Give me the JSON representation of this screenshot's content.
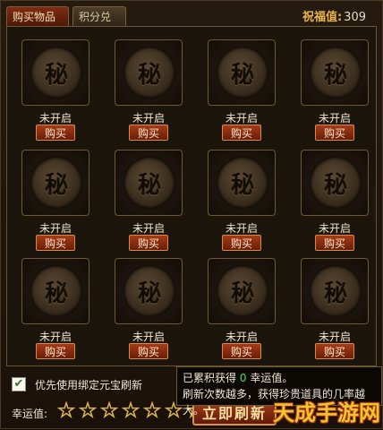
{
  "tabs": [
    {
      "label": "购买物品",
      "active": true
    },
    {
      "label": "积分兑换",
      "active": false
    }
  ],
  "blessing": {
    "label": "祝福值:",
    "value": "309"
  },
  "slots": [
    {
      "glyph": "秘",
      "status": "未开启",
      "buy_label": "购买"
    },
    {
      "glyph": "秘",
      "status": "未开启",
      "buy_label": "购买"
    },
    {
      "glyph": "秘",
      "status": "未开启",
      "buy_label": "购买"
    },
    {
      "glyph": "秘",
      "status": "未开启",
      "buy_label": "购买"
    },
    {
      "glyph": "秘",
      "status": "未开启",
      "buy_label": "购买"
    },
    {
      "glyph": "秘",
      "status": "未开启",
      "buy_label": "购买"
    },
    {
      "glyph": "秘",
      "status": "未开启",
      "buy_label": "购买"
    },
    {
      "glyph": "秘",
      "status": "未开启",
      "buy_label": "购买"
    },
    {
      "glyph": "秘",
      "status": "未开启",
      "buy_label": "购买"
    },
    {
      "glyph": "秘",
      "status": "未开启",
      "buy_label": "购买"
    },
    {
      "glyph": "秘",
      "status": "未开启",
      "buy_label": "购买"
    },
    {
      "glyph": "秘",
      "status": "未开启",
      "buy_label": "购买"
    }
  ],
  "bottom": {
    "checkbox_label": "优先使用绑定元宝刷新",
    "checkbox_checked": true,
    "luck_label": "幸运值:",
    "stars_filled": 0,
    "stars_total": 7,
    "refresh_label": "立即刷新"
  },
  "tooltip": {
    "line1_prefix": "已累积获得",
    "lucky_value": "0",
    "line1_suffix": "幸运值。",
    "line2": "刷新次数越多，获得珍贵道具的几率越大。"
  },
  "watermark": "天成手游网",
  "colors": {
    "accent_gold": "#e9b44c",
    "lucky_green": "#4ce04c",
    "button_red": "#8a2a10"
  }
}
